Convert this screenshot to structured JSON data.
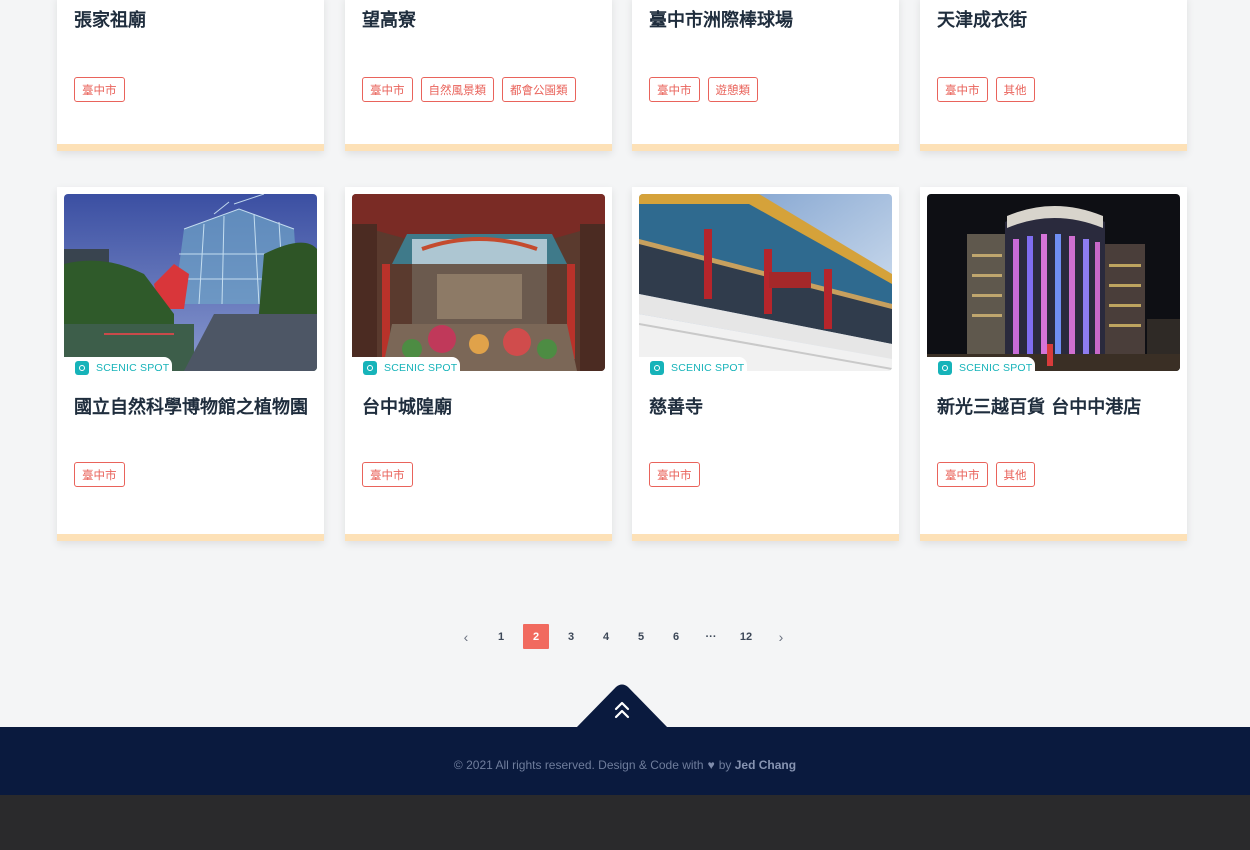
{
  "top_row": [
    {
      "title": "張家祖廟",
      "tags": [
        "臺中市"
      ]
    },
    {
      "title": "望高寮",
      "tags": [
        "臺中市",
        "自然風景類",
        "都會公園類"
      ]
    },
    {
      "title": "臺中市洲際棒球場",
      "tags": [
        "臺中市",
        "遊憩類"
      ]
    },
    {
      "title": "天津成衣街",
      "tags": [
        "臺中市",
        "其他"
      ]
    }
  ],
  "bottom_row": [
    {
      "badge": "SCENIC SPOT",
      "title": "國立自然科學博物館之植物園",
      "tags": [
        "臺中市"
      ],
      "image": "greenhouse-photo"
    },
    {
      "badge": "SCENIC SPOT",
      "title": "台中城隍廟",
      "tags": [
        "臺中市"
      ],
      "image": "temple-interior-photo"
    },
    {
      "badge": "SCENIC SPOT",
      "title": "慈善寺",
      "tags": [
        "臺中市"
      ],
      "image": "temple-exterior-photo"
    },
    {
      "badge": "SCENIC SPOT",
      "title": "新光三越百貨 台中中港店",
      "tags": [
        "臺中市",
        "其他"
      ],
      "image": "department-store-photo"
    }
  ],
  "pagination": {
    "prev": "‹",
    "pages": [
      "1",
      "2",
      "3",
      "4",
      "5",
      "6",
      "···",
      "12"
    ],
    "current": "2",
    "next": "›"
  },
  "footer": {
    "text": "© 2021 All rights reserved. Design & Code with",
    "heart": "♥",
    "by": "by",
    "author": "Jed Chang"
  },
  "colors": {
    "accent": "#f16a5f",
    "tag": "#e9635b",
    "badge": "#16b3b9",
    "card_border": "#fde1b7",
    "footer_bg": "#0a1a3e"
  }
}
